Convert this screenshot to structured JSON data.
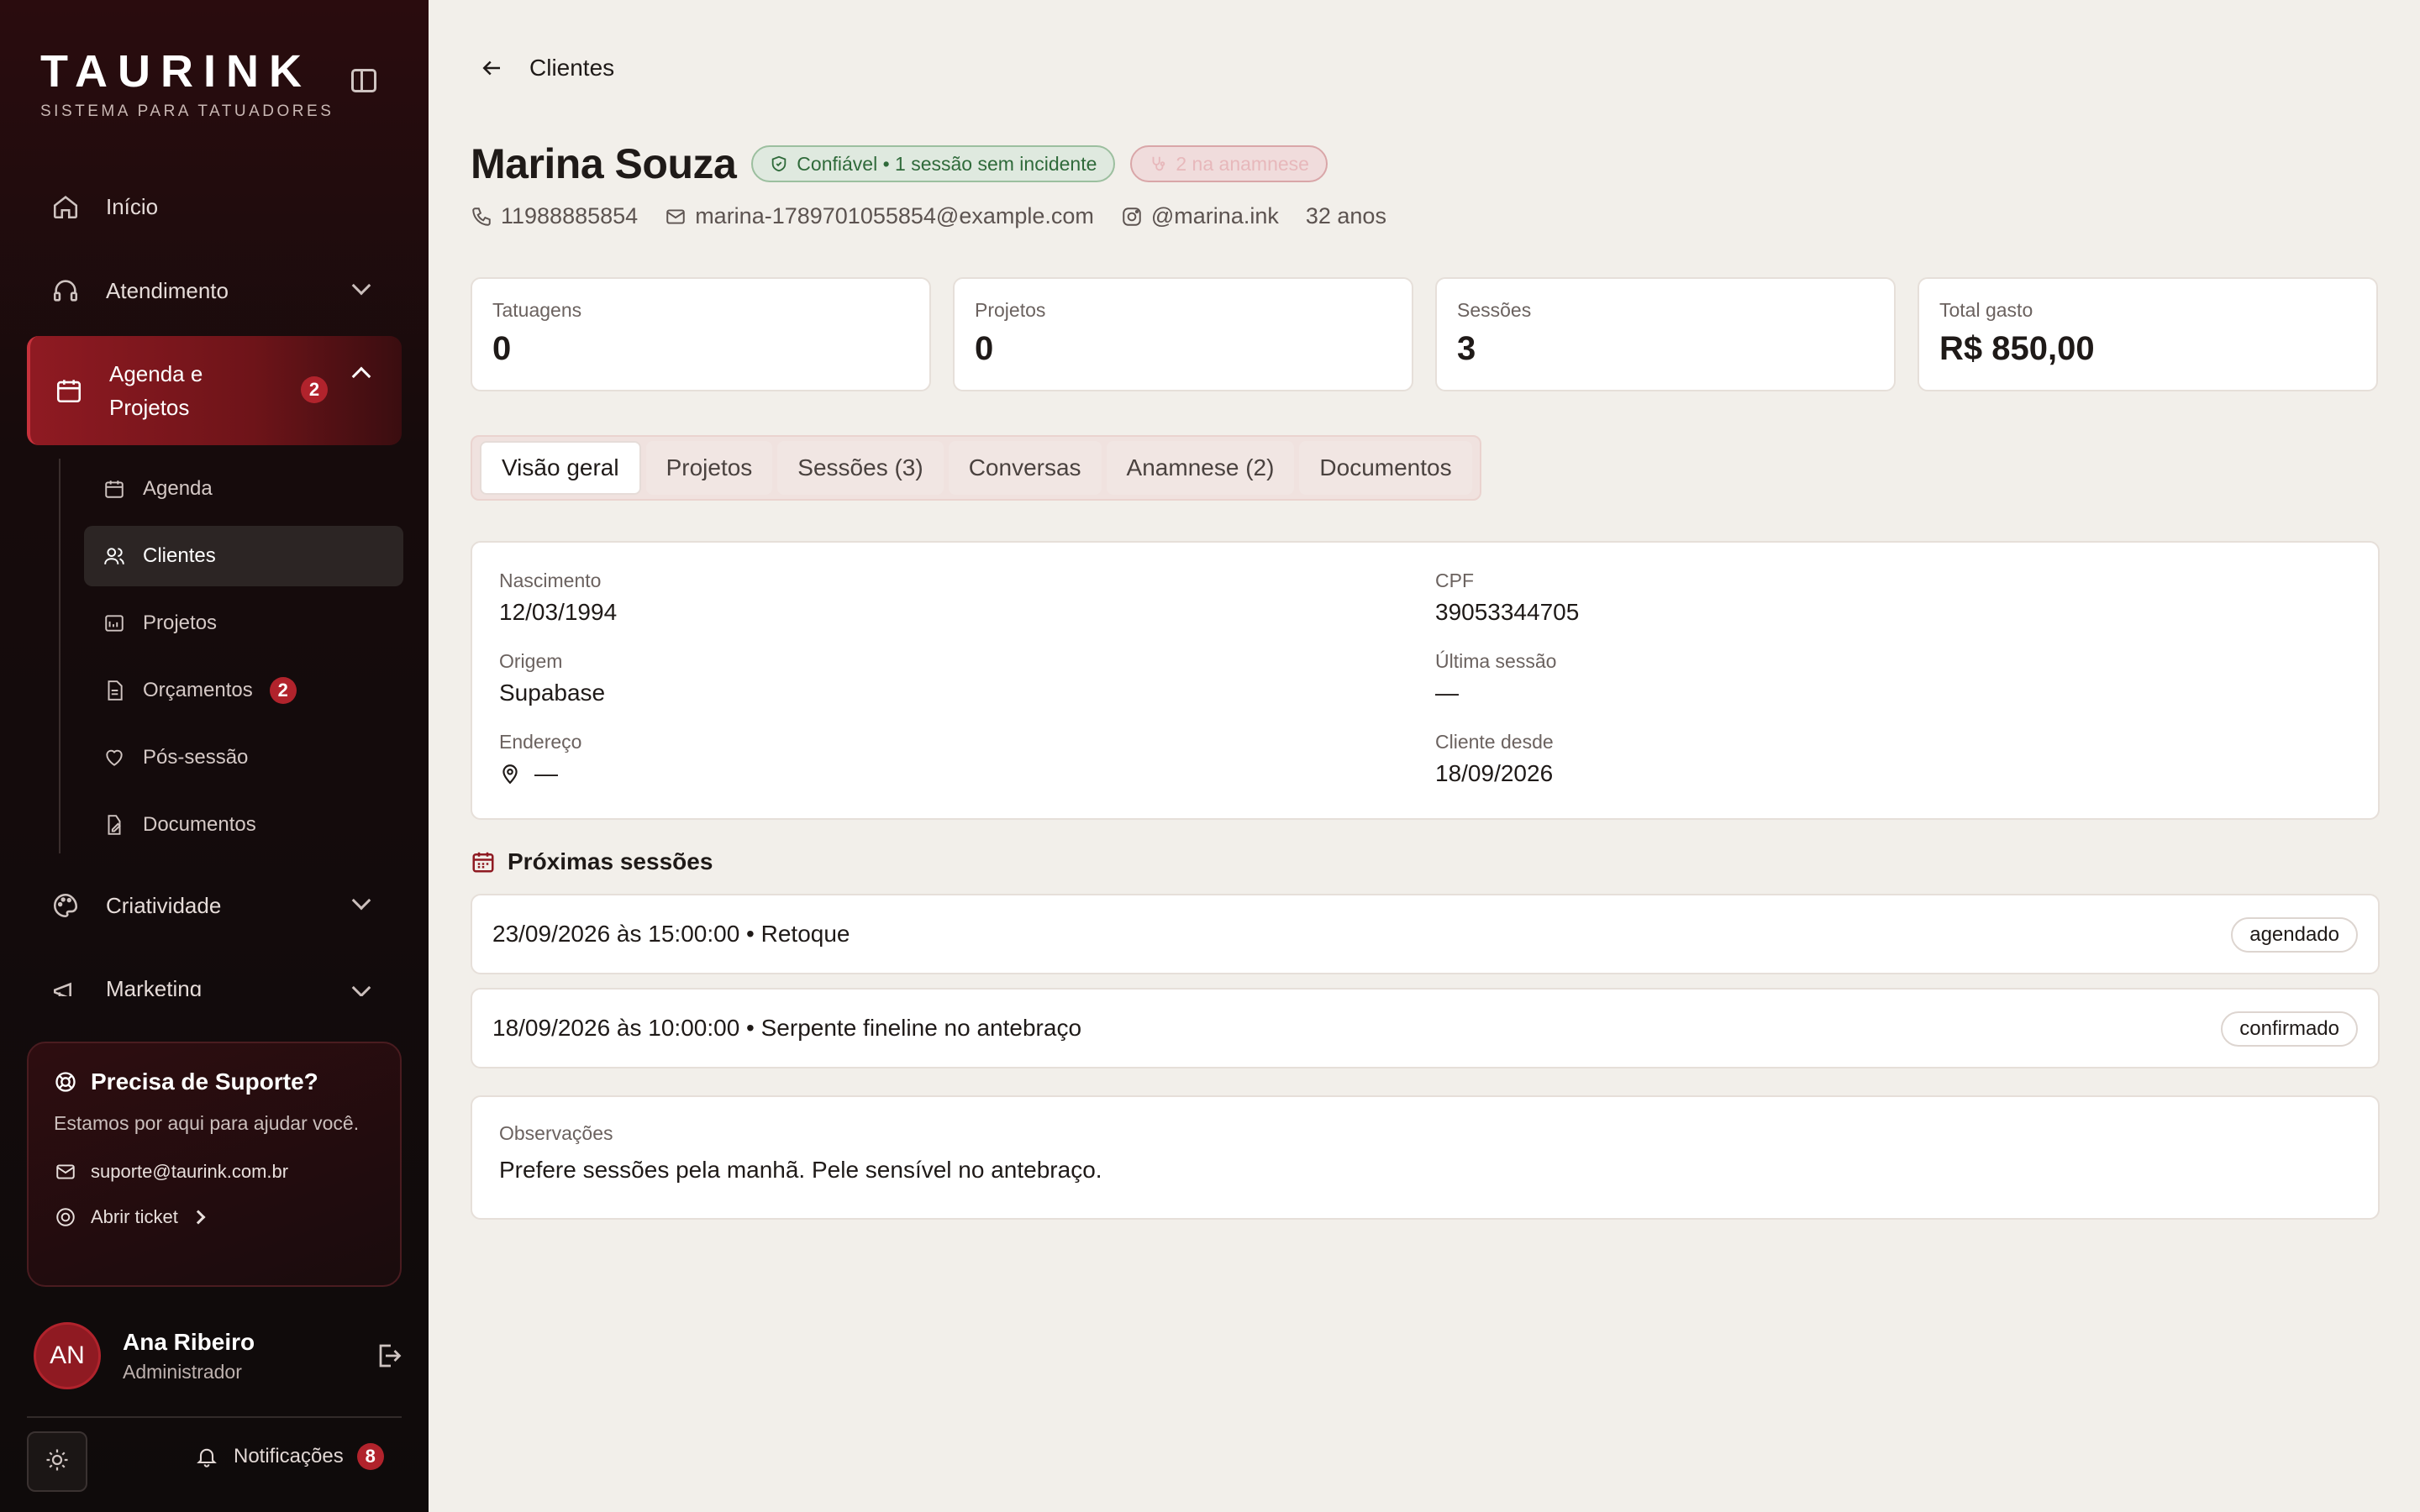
{
  "brand": {
    "logo": "TAURINK",
    "tagline": "SISTEMA PARA TATUADORES"
  },
  "sidebar": {
    "nav": [
      {
        "label": "Início",
        "icon": "home-icon"
      },
      {
        "label": "Atendimento",
        "icon": "headset-icon"
      },
      {
        "label": "Agenda e Projetos",
        "icon": "calendar-icon",
        "badge": "2",
        "active": true
      },
      {
        "label": "Criatividade",
        "icon": "palette-icon"
      },
      {
        "label": "Marketing",
        "icon": "megaphone-icon"
      }
    ],
    "sub": [
      {
        "label": "Agenda",
        "icon": "calendar-icon"
      },
      {
        "label": "Clientes",
        "icon": "users-icon",
        "selected": true
      },
      {
        "label": "Projetos",
        "icon": "image-icon"
      },
      {
        "label": "Orçamentos",
        "icon": "file-icon",
        "badge": "2"
      },
      {
        "label": "Pós-sessão",
        "icon": "heart-icon"
      },
      {
        "label": "Documentos",
        "icon": "edit-file-icon"
      }
    ],
    "support": {
      "title": "Precisa de Suporte?",
      "desc": "Estamos por aqui para ajudar você.",
      "email": "suporte@taurink.com.br",
      "ticket": "Abrir ticket"
    },
    "user": {
      "initials": "AN",
      "name": "Ana Ribeiro",
      "role": "Administrador"
    },
    "notifications": {
      "label": "Notificações",
      "count": "8"
    }
  },
  "main": {
    "back_label": "Clientes",
    "client": {
      "name": "Marina Souza",
      "trust_badge": "Confiável • 1 sessão sem incidente",
      "anamnese_badge": "2 na anamnese",
      "phone": "11988885854",
      "email": "marina-1789701055854@example.com",
      "instagram": "@marina.ink",
      "age": "32 anos"
    },
    "stats": [
      {
        "label": "Tatuagens",
        "value": "0"
      },
      {
        "label": "Projetos",
        "value": "0"
      },
      {
        "label": "Sessões",
        "value": "3"
      },
      {
        "label": "Total gasto",
        "value": "R$ 850,00"
      }
    ],
    "tabs": [
      "Visão geral",
      "Projetos",
      "Sessões (3)",
      "Conversas",
      "Anamnese (2)",
      "Documentos"
    ],
    "info": {
      "nascimento": {
        "label": "Nascimento",
        "value": "12/03/1994"
      },
      "cpf": {
        "label": "CPF",
        "value": "39053344705"
      },
      "origem": {
        "label": "Origem",
        "value": "Supabase"
      },
      "ultima": {
        "label": "Última sessão",
        "value": "—"
      },
      "endereco": {
        "label": "Endereço",
        "value": "—"
      },
      "desde": {
        "label": "Cliente desde",
        "value": "18/09/2026"
      }
    },
    "upcoming_title": "Próximas sessões",
    "sessions": [
      {
        "text": "23/09/2026 às 15:00:00 • Retoque",
        "status": "agendado"
      },
      {
        "text": "18/09/2026 às 10:00:00 • Serpente fineline no antebraço",
        "status": "confirmado"
      }
    ],
    "notes": {
      "label": "Observações",
      "value": "Prefere sessões pela manhã. Pele sensível no antebraço."
    }
  }
}
